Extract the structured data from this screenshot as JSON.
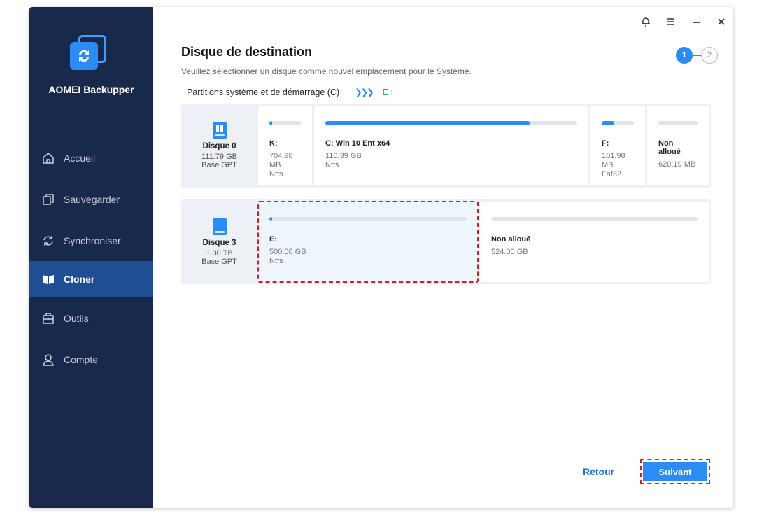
{
  "app": {
    "name": "AOMEI Backupper"
  },
  "sidebar": {
    "items": [
      {
        "label": "Accueil",
        "icon": "home-icon"
      },
      {
        "label": "Sauvegarder",
        "icon": "copy-icon"
      },
      {
        "label": "Synchroniser",
        "icon": "sync-icon"
      },
      {
        "label": "Cloner",
        "icon": "clone-icon",
        "active": true
      },
      {
        "label": "Outils",
        "icon": "toolbox-icon"
      },
      {
        "label": "Compte",
        "icon": "user-icon"
      }
    ]
  },
  "header": {
    "title": "Disque de destination",
    "subtitle": "Veuillez sélectionner un disque comme nouvel emplacement pour le Système.",
    "crumb_source": "Partitions système et de démarrage (C)",
    "crumb_arrows": "❯❯❯",
    "crumb_target": "E :",
    "steps": [
      "1",
      "2"
    ]
  },
  "disks": [
    {
      "name": "Disque 0",
      "size": "111.79 GB",
      "type": "Base GPT",
      "partitions": [
        {
          "name": "K:",
          "size": "704.98 MB",
          "fs": "Ntfs",
          "used": 0.05
        },
        {
          "name": "C: Win 10 Ent x64",
          "size": "110.39 GB",
          "fs": "Ntfs",
          "used": 0.81
        },
        {
          "name": "F:",
          "size": "101.98 MB",
          "fs": "Fat32",
          "used": 0.4
        },
        {
          "name": "Non alloué",
          "size": "620.19 MB",
          "fs": "",
          "used": 0
        }
      ]
    },
    {
      "name": "Disque 3",
      "size": "1.00 TB",
      "type": "Base GPT",
      "partitions": [
        {
          "name": "E:",
          "size": "500.00 GB",
          "fs": "Ntfs",
          "used": 0.01,
          "selected": true
        },
        {
          "name": "Non alloué",
          "size": "524.00 GB",
          "fs": "",
          "used": 0
        }
      ]
    }
  ],
  "footer": {
    "back_label": "Retour",
    "next_label": "Suivant"
  },
  "colors": {
    "accent": "#2b8cf5",
    "sidebar": "#18294b",
    "active_nav": "#1e4f93",
    "highlight": "#d0202a"
  }
}
